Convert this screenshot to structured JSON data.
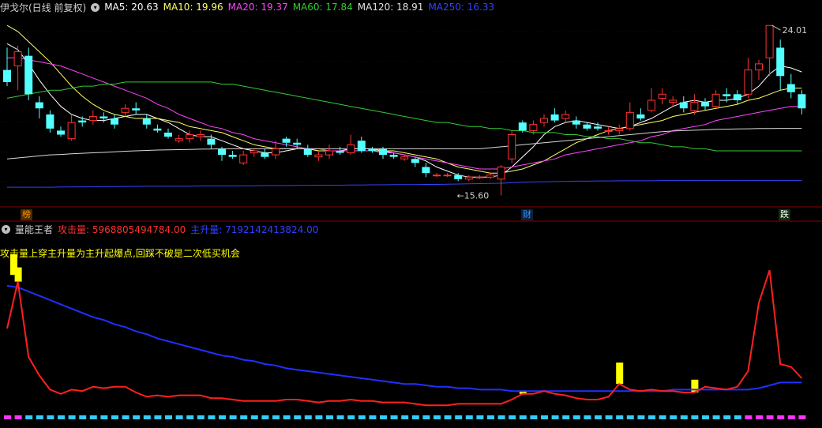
{
  "main_panel": {
    "stock_title": "伊戈尔(日线 前复权)",
    "ma_indicators": [
      {
        "label": "MA5: 20.63",
        "color": "#ffffff"
      },
      {
        "label": "MA10: 19.96",
        "color": "#ffff66"
      },
      {
        "label": "MA20: 19.37",
        "color": "#ff44ff"
      },
      {
        "label": "MA60: 17.84",
        "color": "#33cc33"
      },
      {
        "label": "MA120: 18.91",
        "color": "#e0e0e0"
      },
      {
        "label": "MA250: 16.33",
        "color": "#3344ff"
      }
    ],
    "high_label": "24.01",
    "low_label": "15.60",
    "event_markers": [
      {
        "text": "榜",
        "color": "#ff8800"
      },
      {
        "text": "财",
        "color": "#3399ff"
      },
      {
        "text": "跌",
        "color": "#ffffff"
      }
    ]
  },
  "sub_panel": {
    "indicator_name": "量能王者",
    "attack_label": "攻击量: 5968805494784.00",
    "main_label": "主升量: 7192142413824.00",
    "note": "攻击量上穿主升量为主升起爆点,回踩不破是二次低买机会"
  },
  "colors": {
    "up": "#ff3333",
    "down": "#54ffff",
    "attack": "#ff2020",
    "main_rise": "#2030ff",
    "signal": "#ffff00"
  },
  "chart_data": {
    "type": "candlestick",
    "candles": [
      [
        21.8,
        21.2,
        22.9,
        21.0
      ],
      [
        22.0,
        22.7,
        23.0,
        20.8
      ],
      [
        22.5,
        20.6,
        22.9,
        20.3
      ],
      [
        20.2,
        19.9,
        20.5,
        19.4
      ],
      [
        19.6,
        18.9,
        19.8,
        18.7
      ],
      [
        18.8,
        18.6,
        19.0,
        18.5
      ],
      [
        18.4,
        19.2,
        19.6,
        18.3
      ],
      [
        19.3,
        19.2,
        19.5,
        19.0
      ],
      [
        19.3,
        19.5,
        19.8,
        19.1
      ],
      [
        19.5,
        19.4,
        19.7,
        19.2
      ],
      [
        19.4,
        19.1,
        19.6,
        18.9
      ],
      [
        19.7,
        19.9,
        20.1,
        19.5
      ],
      [
        19.9,
        19.8,
        20.2,
        19.6
      ],
      [
        19.4,
        19.1,
        19.6,
        18.9
      ],
      [
        18.9,
        18.8,
        19.1,
        18.7
      ],
      [
        18.7,
        18.5,
        18.9,
        18.4
      ],
      [
        18.3,
        18.4,
        18.6,
        18.2
      ],
      [
        18.4,
        18.6,
        18.8,
        18.2
      ],
      [
        18.5,
        18.6,
        18.8,
        18.3
      ],
      [
        18.4,
        18.1,
        18.6,
        17.9
      ],
      [
        17.9,
        17.6,
        18.0,
        17.3
      ],
      [
        17.6,
        17.5,
        17.8,
        17.4
      ],
      [
        17.2,
        17.6,
        17.8,
        17.1
      ],
      [
        17.7,
        17.8,
        17.9,
        17.5
      ],
      [
        17.7,
        17.5,
        17.9,
        17.4
      ],
      [
        17.6,
        17.9,
        18.3,
        17.4
      ],
      [
        18.4,
        18.2,
        18.5,
        18.0
      ],
      [
        18.2,
        18.1,
        18.4,
        17.9
      ],
      [
        17.9,
        17.6,
        18.1,
        17.5
      ],
      [
        17.5,
        17.6,
        17.8,
        17.3
      ],
      [
        17.6,
        17.8,
        18.1,
        17.4
      ],
      [
        17.8,
        17.7,
        18.0,
        17.6
      ],
      [
        17.7,
        18.1,
        18.6,
        17.6
      ],
      [
        18.3,
        17.8,
        18.5,
        17.7
      ],
      [
        17.9,
        17.8,
        18.0,
        17.7
      ],
      [
        17.9,
        17.6,
        18.0,
        17.4
      ],
      [
        17.6,
        17.5,
        17.7,
        17.4
      ],
      [
        17.4,
        17.5,
        17.6,
        17.3
      ],
      [
        17.4,
        17.2,
        17.5,
        17.0
      ],
      [
        17.0,
        16.7,
        17.2,
        16.5
      ],
      [
        16.6,
        16.6,
        16.7,
        16.5
      ],
      [
        16.6,
        16.6,
        16.7,
        16.5
      ],
      [
        16.6,
        16.4,
        16.7,
        16.3
      ],
      [
        16.4,
        16.5,
        16.6,
        16.3
      ],
      [
        16.5,
        16.5,
        16.6,
        16.4
      ],
      [
        16.5,
        16.6,
        16.7,
        16.4
      ],
      [
        16.4,
        17.0,
        17.1,
        15.6
      ],
      [
        17.4,
        18.6,
        18.8,
        17.2
      ],
      [
        19.2,
        18.8,
        19.3,
        18.7
      ],
      [
        18.8,
        19.1,
        19.3,
        18.6
      ],
      [
        19.2,
        19.4,
        19.6,
        19.0
      ],
      [
        19.6,
        19.3,
        19.9,
        19.2
      ],
      [
        19.4,
        19.6,
        19.8,
        19.2
      ],
      [
        19.3,
        19.1,
        19.5,
        18.9
      ],
      [
        19.1,
        18.9,
        19.2,
        18.8
      ],
      [
        19.0,
        18.9,
        19.2,
        18.8
      ],
      [
        18.8,
        18.8,
        19.0,
        18.6
      ],
      [
        18.8,
        18.9,
        19.1,
        18.6
      ],
      [
        18.9,
        19.7,
        20.2,
        18.8
      ],
      [
        19.6,
        19.4,
        19.9,
        19.3
      ],
      [
        19.8,
        20.3,
        20.9,
        19.7
      ],
      [
        20.4,
        20.6,
        20.9,
        20.1
      ],
      [
        20.2,
        20.3,
        20.5,
        20.0
      ],
      [
        20.2,
        19.9,
        20.5,
        19.7
      ],
      [
        19.8,
        20.2,
        20.6,
        19.6
      ],
      [
        20.2,
        20.0,
        20.4,
        19.8
      ],
      [
        20.0,
        20.6,
        20.8,
        19.9
      ],
      [
        20.6,
        20.5,
        20.9,
        20.2
      ],
      [
        20.6,
        20.3,
        20.8,
        20.1
      ],
      [
        20.6,
        21.8,
        22.4,
        20.4
      ],
      [
        21.8,
        22.1,
        22.3,
        21.3
      ],
      [
        22.4,
        24.0,
        24.0,
        21.5
      ],
      [
        22.9,
        21.5,
        23.3,
        20.8
      ],
      [
        21.1,
        20.7,
        21.6,
        20.4
      ],
      [
        20.6,
        19.9,
        20.8,
        19.6
      ]
    ],
    "ma_lines": {
      "MA5": [
        23.1,
        22.8,
        22.1,
        21.3,
        20.6,
        20.0,
        19.6,
        19.4,
        19.3,
        19.3,
        19.4,
        19.5,
        19.6,
        19.6,
        19.4,
        19.2,
        18.9,
        18.6,
        18.5,
        18.5,
        18.3,
        18.1,
        17.9,
        17.8,
        17.7,
        17.7,
        17.8,
        17.9,
        17.9,
        17.8,
        17.8,
        17.8,
        17.9,
        17.9,
        17.9,
        17.8,
        17.7,
        17.6,
        17.5,
        17.3,
        17.0,
        16.8,
        16.6,
        16.5,
        16.5,
        16.5,
        16.6,
        17.0,
        17.5,
        18.0,
        18.6,
        19.0,
        19.2,
        19.3,
        19.2,
        19.1,
        19.0,
        18.9,
        19.0,
        19.2,
        19.4,
        19.7,
        20.0,
        20.2,
        20.3,
        20.2,
        20.3,
        20.3,
        20.4,
        20.6,
        21.0,
        21.6,
        22.0,
        21.9,
        21.7
      ],
      "MA10": [
        24.0,
        23.7,
        23.2,
        22.7,
        22.2,
        21.6,
        21.0,
        20.5,
        20.1,
        19.8,
        19.6,
        19.5,
        19.4,
        19.4,
        19.4,
        19.3,
        19.2,
        19.0,
        18.9,
        18.8,
        18.7,
        18.5,
        18.3,
        18.1,
        18.0,
        17.9,
        17.9,
        17.9,
        17.9,
        17.8,
        17.8,
        17.8,
        17.8,
        17.8,
        17.8,
        17.8,
        17.8,
        17.7,
        17.6,
        17.5,
        17.4,
        17.2,
        17.0,
        16.9,
        16.8,
        16.7,
        16.7,
        16.8,
        16.9,
        17.1,
        17.3,
        17.6,
        17.9,
        18.2,
        18.4,
        18.6,
        18.8,
        18.9,
        19.0,
        19.1,
        19.2,
        19.3,
        19.5,
        19.6,
        19.7,
        19.8,
        19.9,
        20.0,
        20.1,
        20.3,
        20.4,
        20.6,
        20.8,
        20.9,
        20.9
      ],
      "MA20": [
        22.4,
        22.4,
        22.3,
        22.2,
        22.1,
        22.0,
        21.8,
        21.6,
        21.4,
        21.2,
        21.0,
        20.8,
        20.6,
        20.4,
        20.1,
        19.9,
        19.6,
        19.4,
        19.2,
        19.0,
        18.9,
        18.7,
        18.6,
        18.4,
        18.3,
        18.2,
        18.1,
        18.0,
        17.9,
        17.9,
        17.8,
        17.8,
        17.8,
        17.8,
        17.8,
        17.7,
        17.7,
        17.6,
        17.5,
        17.4,
        17.3,
        17.2,
        17.1,
        17.0,
        16.9,
        16.9,
        16.9,
        17.0,
        17.1,
        17.2,
        17.3,
        17.4,
        17.6,
        17.7,
        17.8,
        17.9,
        18.0,
        18.1,
        18.2,
        18.3,
        18.5,
        18.6,
        18.8,
        18.9,
        19.0,
        19.1,
        19.3,
        19.4,
        19.5,
        19.6,
        19.7,
        19.8,
        19.9,
        20.0,
        20.0
      ],
      "MA60": [
        20.4,
        20.5,
        20.6,
        20.7,
        20.8,
        20.8,
        20.9,
        21.0,
        21.0,
        21.1,
        21.1,
        21.2,
        21.2,
        21.2,
        21.2,
        21.2,
        21.2,
        21.2,
        21.2,
        21.2,
        21.1,
        21.1,
        21.0,
        20.9,
        20.8,
        20.7,
        20.6,
        20.5,
        20.4,
        20.3,
        20.2,
        20.1,
        20.0,
        19.9,
        19.8,
        19.7,
        19.6,
        19.5,
        19.4,
        19.3,
        19.2,
        19.2,
        19.1,
        19.0,
        19.0,
        18.9,
        18.9,
        18.8,
        18.8,
        18.7,
        18.7,
        18.7,
        18.6,
        18.6,
        18.5,
        18.5,
        18.4,
        18.4,
        18.3,
        18.2,
        18.2,
        18.1,
        18.0,
        18.0,
        17.9,
        17.9,
        17.8,
        17.8,
        17.8,
        17.8,
        17.8,
        17.8,
        17.8,
        17.8,
        17.8
      ],
      "MA120": [
        17.4,
        17.45,
        17.5,
        17.55,
        17.6,
        17.62,
        17.65,
        17.68,
        17.7,
        17.72,
        17.75,
        17.78,
        17.8,
        17.82,
        17.84,
        17.85,
        17.86,
        17.87,
        17.88,
        17.89,
        17.9,
        17.9,
        17.9,
        17.9,
        17.9,
        17.9,
        17.9,
        17.9,
        17.9,
        17.9,
        17.9,
        17.9,
        17.9,
        17.9,
        17.9,
        17.9,
        17.9,
        17.9,
        17.9,
        17.9,
        17.9,
        17.9,
        17.9,
        17.9,
        17.9,
        17.95,
        18.0,
        18.05,
        18.1,
        18.15,
        18.2,
        18.25,
        18.3,
        18.35,
        18.4,
        18.45,
        18.5,
        18.55,
        18.6,
        18.65,
        18.7,
        18.75,
        18.78,
        18.8,
        18.82,
        18.84,
        18.86,
        18.87,
        18.88,
        18.89,
        18.9,
        18.9,
        18.91,
        18.91,
        18.91
      ],
      "MA250": [
        16.0,
        16.0,
        16.0,
        16.0,
        16.0,
        16.01,
        16.01,
        16.02,
        16.02,
        16.03,
        16.03,
        16.04,
        16.04,
        16.05,
        16.05,
        16.05,
        16.05,
        16.05,
        16.06,
        16.06,
        16.06,
        16.06,
        16.07,
        16.07,
        16.08,
        16.08,
        16.08,
        16.09,
        16.09,
        16.1,
        16.1,
        16.1,
        16.11,
        16.11,
        16.12,
        16.12,
        16.13,
        16.13,
        16.13,
        16.14,
        16.14,
        16.15,
        16.16,
        16.17,
        16.18,
        16.19,
        16.2,
        16.22,
        16.24,
        16.26,
        16.27,
        16.28,
        16.29,
        16.3,
        16.3,
        16.31,
        16.31,
        16.32,
        16.32,
        16.32,
        16.32,
        16.33,
        16.33,
        16.33,
        16.33,
        16.33,
        16.33,
        16.33,
        16.33,
        16.33,
        16.33,
        16.33,
        16.33,
        16.33,
        16.33
      ]
    },
    "attack_series": [
      0.55,
      0.88,
      0.35,
      0.22,
      0.12,
      0.09,
      0.12,
      0.11,
      0.14,
      0.13,
      0.14,
      0.14,
      0.1,
      0.07,
      0.08,
      0.07,
      0.08,
      0.08,
      0.08,
      0.06,
      0.06,
      0.05,
      0.04,
      0.04,
      0.04,
      0.04,
      0.05,
      0.05,
      0.04,
      0.03,
      0.04,
      0.04,
      0.05,
      0.04,
      0.04,
      0.03,
      0.03,
      0.03,
      0.02,
      0.01,
      0.01,
      0.01,
      0.02,
      0.02,
      0.02,
      0.02,
      0.02,
      0.05,
      0.09,
      0.09,
      0.11,
      0.09,
      0.08,
      0.06,
      0.05,
      0.05,
      0.07,
      0.16,
      0.12,
      0.11,
      0.12,
      0.11,
      0.11,
      0.1,
      0.1,
      0.14,
      0.13,
      0.12,
      0.14,
      0.25,
      0.73,
      0.96,
      0.3,
      0.28,
      0.2
    ],
    "main_rise_series": [
      0.85,
      0.84,
      0.81,
      0.78,
      0.75,
      0.72,
      0.69,
      0.66,
      0.63,
      0.61,
      0.58,
      0.56,
      0.53,
      0.51,
      0.48,
      0.46,
      0.44,
      0.42,
      0.4,
      0.38,
      0.36,
      0.35,
      0.33,
      0.32,
      0.3,
      0.29,
      0.27,
      0.26,
      0.25,
      0.24,
      0.23,
      0.22,
      0.21,
      0.2,
      0.19,
      0.18,
      0.17,
      0.16,
      0.16,
      0.15,
      0.14,
      0.14,
      0.13,
      0.13,
      0.12,
      0.12,
      0.12,
      0.11,
      0.11,
      0.11,
      0.11,
      0.11,
      0.11,
      0.11,
      0.11,
      0.11,
      0.11,
      0.11,
      0.11,
      0.11,
      0.11,
      0.11,
      0.12,
      0.12,
      0.12,
      0.12,
      0.12,
      0.12,
      0.12,
      0.12,
      0.13,
      0.15,
      0.17,
      0.17,
      0.17
    ],
    "signal_bars": [
      {
        "i": 1,
        "v": 0.1
      },
      {
        "i": 48,
        "v": 0.02
      },
      {
        "i": 57,
        "v": 0.15
      },
      {
        "i": 64,
        "v": 0.09
      }
    ],
    "volume_bars": [
      2,
      2,
      2,
      2,
      2,
      2,
      2,
      2,
      2,
      2,
      2,
      2,
      2,
      2,
      2,
      2,
      2,
      2,
      2,
      2,
      2,
      2,
      2,
      2,
      2,
      2,
      2,
      2,
      2,
      2,
      2,
      2,
      2,
      2,
      2,
      2,
      2,
      2,
      2,
      2,
      2,
      2,
      2,
      2,
      2,
      2,
      2,
      2,
      2,
      2,
      2,
      2,
      2,
      2,
      2,
      2,
      2,
      2,
      2,
      2,
      2,
      2,
      2,
      2,
      2,
      2,
      2,
      2,
      2,
      2,
      2,
      2,
      2,
      2,
      2
    ]
  }
}
